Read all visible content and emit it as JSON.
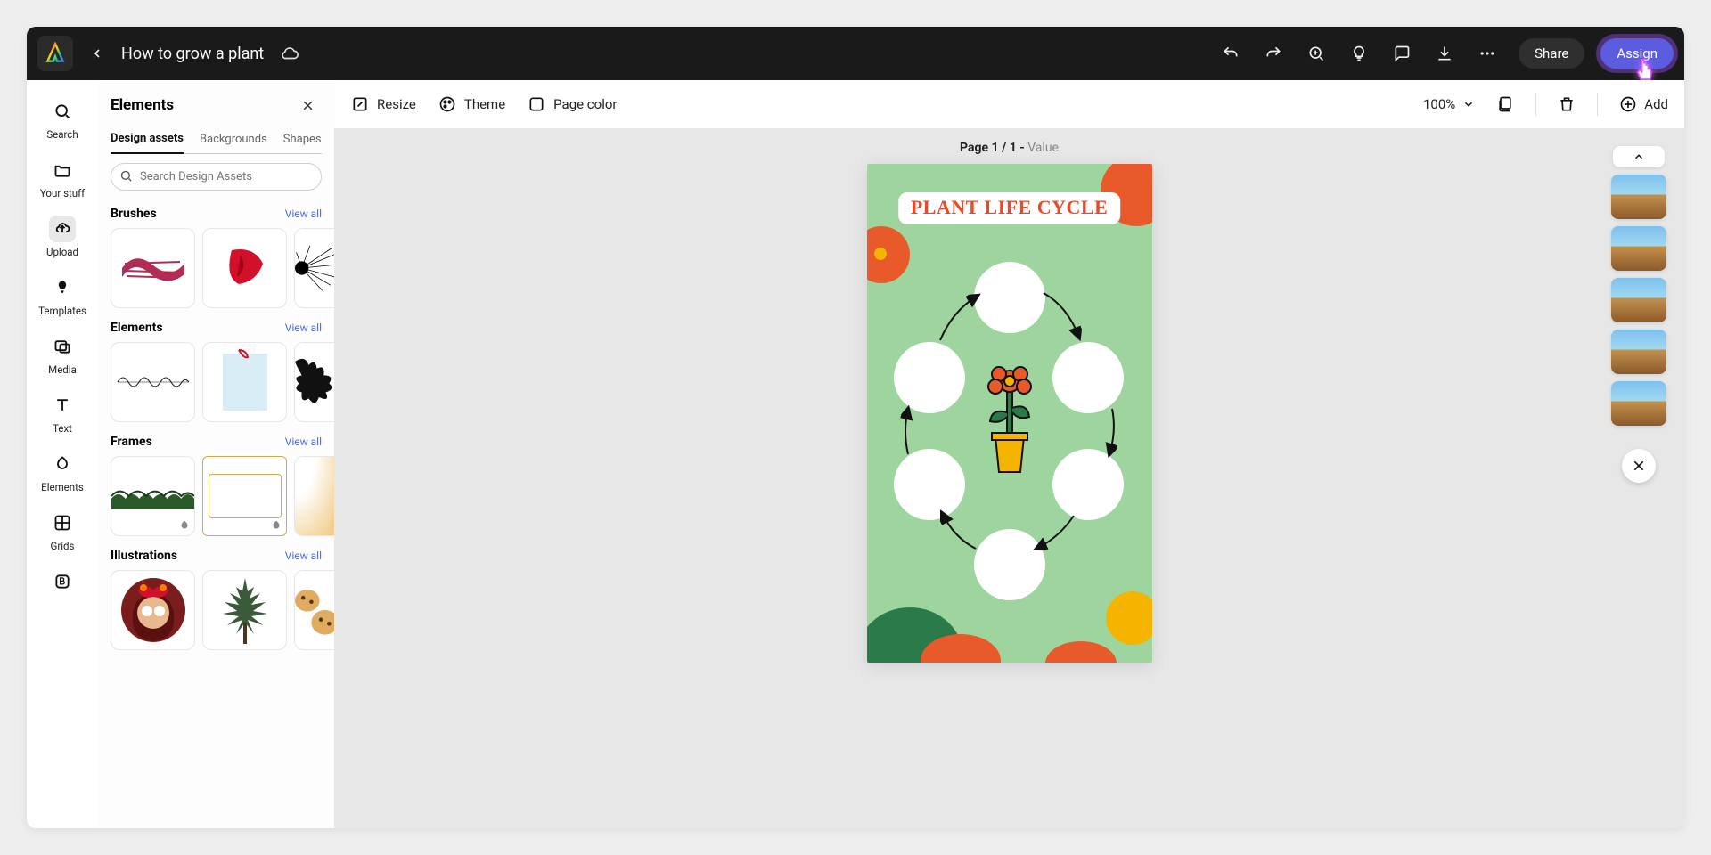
{
  "header": {
    "doc_title": "How to grow a plant",
    "share_label": "Share",
    "assign_label": "Assign"
  },
  "rail": {
    "items": [
      {
        "label": "Search"
      },
      {
        "label": "Your stuff"
      },
      {
        "label": "Upload"
      },
      {
        "label": "Templates"
      },
      {
        "label": "Media"
      },
      {
        "label": "Text"
      },
      {
        "label": "Elements"
      },
      {
        "label": "Grids"
      }
    ]
  },
  "panel": {
    "title": "Elements",
    "tabs": [
      "Design assets",
      "Backgrounds",
      "Shapes"
    ],
    "search_placeholder": "Search Design Assets",
    "sections": [
      {
        "name": "Brushes",
        "view_all": "View all"
      },
      {
        "name": "Elements",
        "view_all": "View all"
      },
      {
        "name": "Frames",
        "view_all": "View all"
      },
      {
        "name": "Illustrations",
        "view_all": "View all"
      }
    ]
  },
  "toolbar": {
    "resize": "Resize",
    "theme": "Theme",
    "page_color": "Page color",
    "zoom": "100%",
    "add": "Add"
  },
  "canvas": {
    "page_label_strong": "Page 1 / 1 - ",
    "page_label_sub": "Value",
    "art_title": "Plant Life Cycle"
  }
}
